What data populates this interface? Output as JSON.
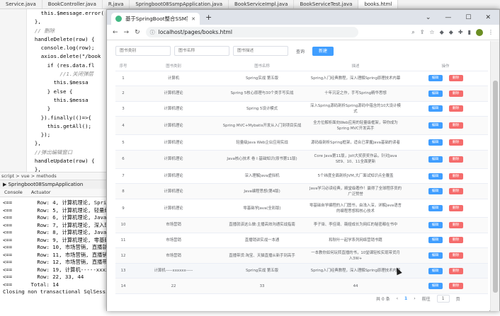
{
  "ide": {
    "tabs": [
      "Service.java",
      "BookController.java",
      "R.java",
      "Springboot08SsmpApplication.java",
      "BookServiceImpl.java",
      "BookServiceTest.java",
      "books.html"
    ],
    "code_lines": [
      "    this.$message.error(",
      "  },",
      "  // 删除",
      "  handleDelete(row) {",
      "    console.log(row);",
      "    axios.delete(\"/book",
      "      if (res.data.fl",
      "          //1.关闭弹层",
      "        this.$messa",
      "      } else {",
      "        this.$messa",
      "      }",
      "    }).finally(()=>{",
      "      this.getAll();",
      "    });",
      "  },",
      "",
      "  //弹出编辑窗口",
      "  handleUpdate(row) {",
      "  },"
    ],
    "breadcrumb": "script  >  vue  >  methods",
    "run_title": "Springboot08SsmpApplication",
    "run_tabs": [
      "Console",
      "Actuator"
    ],
    "console_lines": [
      "<==        Row: 4, 计算机理论, Spring",
      "<==        Row: 5, 计算机理论, 轻量级J",
      "<==        Row: 6, 计算机理论, Java核",
      "<==        Row: 7, 计算机理论, 深入理解",
      "<==        Row: 8, 计算机理论, Java编",
      "<==        Row: 9, 计算机理论, 零基础学",
      "<==        Row: 10, 市场营销, 直播就这",
      "<==        Row: 11, 市场营销, 直播销讲",
      "<==        Row: 12, 市场营销, 直播带货",
      "<==        Row: 19, 计算机-----xxxxx-",
      "<==        Row: 22, 33, 44",
      "<==      Total: 14",
      "Closing non transactional SqlSession"
    ]
  },
  "browser": {
    "tab_title": "基于SpringBoot整合SSM案例",
    "url": "localhost/pages/books.html",
    "search": {
      "type_placeholder": "图书类别",
      "name_placeholder": "图书名称",
      "desc_placeholder": "图书描述",
      "query_label": "查询",
      "new_label": "新建"
    },
    "columns": [
      "序号",
      "图书类别",
      "图书名称",
      "描述",
      "操作"
    ],
    "edit_label": "编辑",
    "delete_label": "删除",
    "rows": [
      {
        "no": "1",
        "type": "计算机",
        "name": "Spring实战 第五版",
        "desc": "Spring入门经典教程，深入理解Spring原理技术内幕"
      },
      {
        "no": "2",
        "type": "计算机理论",
        "name": "Spring 5核心原理与30个类手写实战",
        "desc": "十年沉淀之作，手写Spring精华思想"
      },
      {
        "no": "3",
        "type": "计算机理论",
        "name": "Spring 5设计模式",
        "desc": "深入Spring源码剖析Spring源码中蕴含的10大设计模式"
      },
      {
        "no": "4",
        "type": "计算机理论",
        "name": "Spring MVC+Mybatis开发从入门到项目实战",
        "desc": "全方位解析面向Web应用的轻量级框架，带你成为Spring MVC开发高手"
      },
      {
        "no": "5",
        "type": "计算机理论",
        "name": "轻量级Java Web企业应用实战",
        "desc": "源码级剖析Spring框架，适合已掌握Java基础的读者"
      },
      {
        "no": "6",
        "type": "计算机理论",
        "name": "Java核心技术 卷 I 基础知识(原书第11版)",
        "desc": "Core Java第11版，Jolt大奖获奖作品，针对Java SE9、10、11全面更新"
      },
      {
        "no": "7",
        "type": "计算机理论",
        "name": "深入理解Java虚拟机",
        "desc": "5个纬度全面剖析JVM,大厂面试知识点全覆盖"
      },
      {
        "no": "8",
        "type": "计算机理论",
        "name": "Java编程思想(第4版)",
        "desc": "Java学习必读经典，殿堂级著作！赢得了全球程序员的广泛赞誉"
      },
      {
        "no": "9",
        "type": "计算机理论",
        "name": "零基础学Java(全彩版)",
        "desc": "零基础自学编程的入门图书，由浅入深，详解Java语言的编程思想和核心技术"
      },
      {
        "no": "10",
        "type": "市场营销",
        "name": "直播就该这么做:主播高效沟通实战指南",
        "desc": "李子柒、李佳琦、薇娅成长为网红的秘密都在书中"
      },
      {
        "no": "11",
        "type": "市场营销",
        "name": "直播销讲实战一本通",
        "desc": "和秋叶一起学系列网络营销书籍"
      },
      {
        "no": "12",
        "type": "市场营销",
        "name": "直播带货:淘宝、天猫直播从新手到高手",
        "desc": "一本教你如何玩转直播的书，10堂课轻松实现带货月入3W+"
      },
      {
        "no": "13",
        "type": "计算机-----xxxxxx-----",
        "name": "Spring实战 第五版",
        "desc": "Spring入门经典教程，深入理解Spring原理技术内幕"
      },
      {
        "no": "14",
        "type": "22",
        "name": "33",
        "desc": "44"
      }
    ],
    "pager": {
      "total_label": "共 0 条",
      "prev": "‹",
      "page": "1",
      "next": "›",
      "goto_label": "前往",
      "goto_value": "1",
      "page_suffix": "页"
    }
  }
}
